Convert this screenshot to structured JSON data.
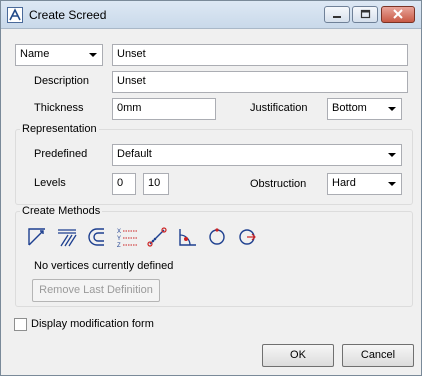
{
  "window": {
    "title": "Create Screed"
  },
  "name_row": {
    "selector_value": "Name",
    "value": "Unset"
  },
  "description": {
    "label": "Description",
    "value": "Unset"
  },
  "thickness": {
    "label": "Thickness",
    "value": "0mm"
  },
  "justification": {
    "label": "Justification",
    "value": "Bottom"
  },
  "representation": {
    "title": "Representation",
    "predefined_label": "Predefined",
    "predefined_value": "Default",
    "levels_label": "Levels",
    "level_min": "0",
    "level_max": "10",
    "obstruction_label": "Obstruction",
    "obstruction_value": "Hard"
  },
  "create_methods": {
    "title": "Create Methods",
    "tools": [
      "explicit-line-icon",
      "offset-lines-icon",
      "arc-profile-icon",
      "xyz-coordinates-icon",
      "line-by-points-icon",
      "angle-arc-icon",
      "circle-icon",
      "circle-arrow-icon"
    ],
    "status_text": "No vertices currently defined",
    "remove_button": "Remove Last Definition"
  },
  "display_modification_form": {
    "label": "Display modification form",
    "checked": false
  },
  "buttons": {
    "ok": "OK",
    "cancel": "Cancel"
  },
  "colors": {
    "tool_stroke": "#1d3f8f",
    "tool_red": "#cc2222"
  }
}
